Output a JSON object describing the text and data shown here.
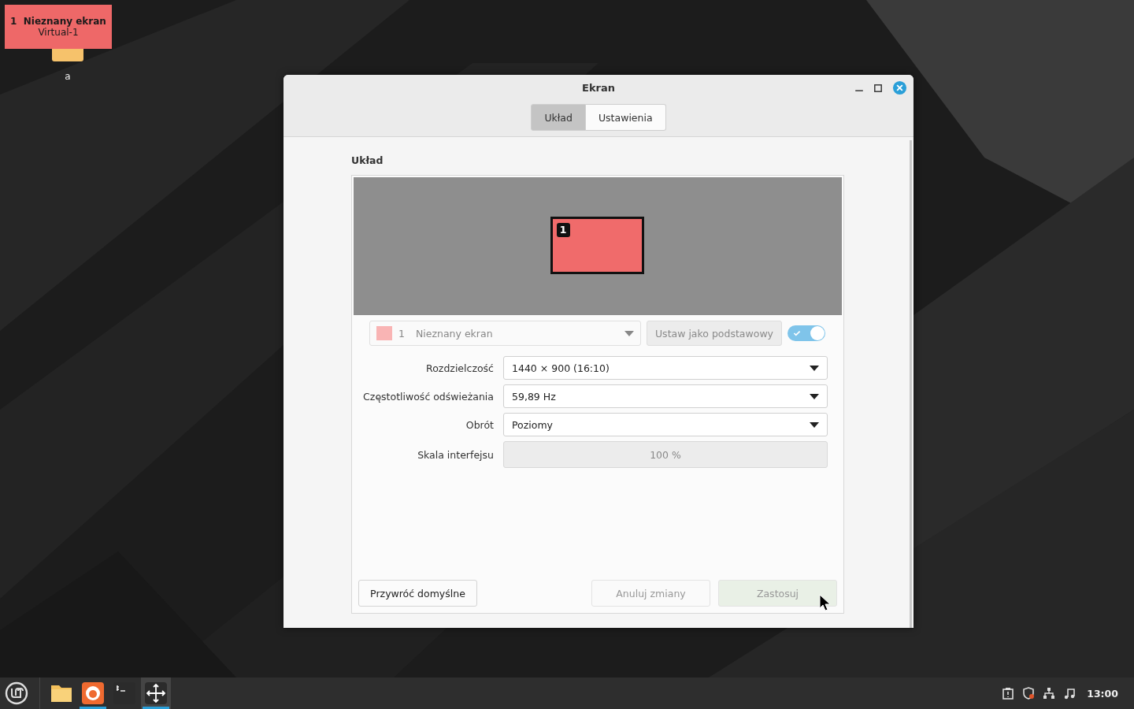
{
  "desktop_overlay": {
    "number": "1",
    "name": "Nieznany ekran",
    "output": "Virtual-1"
  },
  "desktop_icons": [
    {
      "label": "a"
    }
  ],
  "window": {
    "title": "Ekran"
  },
  "tabs": [
    {
      "label": "Układ",
      "selected": true
    },
    {
      "label": "Ustawienia",
      "selected": false
    }
  ],
  "section_title": "Układ",
  "monitors": [
    {
      "number": "1"
    }
  ],
  "monitor_select": {
    "number": "1",
    "name": "Nieznany ekran",
    "disabled": true
  },
  "primary_button": {
    "label": "Ustaw jako podstawowy",
    "disabled": true
  },
  "enabled_switch": {
    "on": true
  },
  "settings": [
    {
      "kind": "dropdown",
      "label": "Rozdzielczość",
      "value": "1440 × 900 (16:10)"
    },
    {
      "kind": "dropdown",
      "label": "Częstotliwość odświeżania",
      "value": "59,89 Hz"
    },
    {
      "kind": "dropdown",
      "label": "Obrót",
      "value": "Poziomy"
    },
    {
      "kind": "scale",
      "label": "Skala interfejsu",
      "value": "100 %",
      "disabled": true
    }
  ],
  "buttons": [
    {
      "label": "Przywróć domyślne",
      "disabled": false,
      "kind": "normal"
    },
    {
      "label": "Anuluj zmiany",
      "disabled": true,
      "kind": "normal"
    },
    {
      "label": "Zastosuj",
      "disabled": true,
      "kind": "suggested"
    }
  ],
  "taskbar": {
    "apps": [
      {
        "kind": "files",
        "running": false,
        "focused": false
      },
      {
        "kind": "firefox",
        "running": true,
        "focused": false
      },
      {
        "kind": "terminal",
        "running": false,
        "focused": false
      },
      {
        "kind": "display",
        "running": true,
        "focused": true
      }
    ],
    "clock": "13:00"
  }
}
